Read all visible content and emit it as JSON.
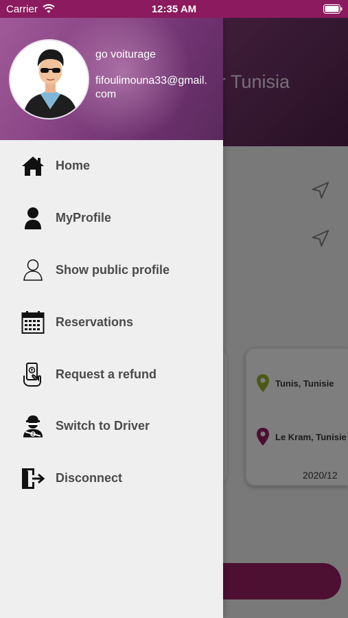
{
  "status_bar": {
    "carrier": "Carrier",
    "time": "12:35 AM"
  },
  "drawer": {
    "user_name": "go voiturage",
    "user_email": "fifoulimouna33@gmail.com",
    "menu": [
      {
        "label": "Home",
        "icon": "home-icon"
      },
      {
        "label": "MyProfile",
        "icon": "user-filled-icon"
      },
      {
        "label": "Show public profile",
        "icon": "user-outline-icon"
      },
      {
        "label": "Reservations",
        "icon": "calendar-icon"
      },
      {
        "label": "Request a refund",
        "icon": "refund-hand-icon"
      },
      {
        "label": "Switch to Driver",
        "icon": "driver-icon"
      },
      {
        "label": "Disconnect",
        "icon": "logout-door-icon"
      }
    ]
  },
  "background": {
    "title_fragment": "er Tunisia",
    "card": {
      "from": "Tunis, Tunisie",
      "to": "Le Kram, Tunisie",
      "date": "2020/12"
    }
  },
  "colors": {
    "accent": "#8b1a5e",
    "from_pin": "#8aa02a",
    "to_pin": "#8b1a5e"
  }
}
